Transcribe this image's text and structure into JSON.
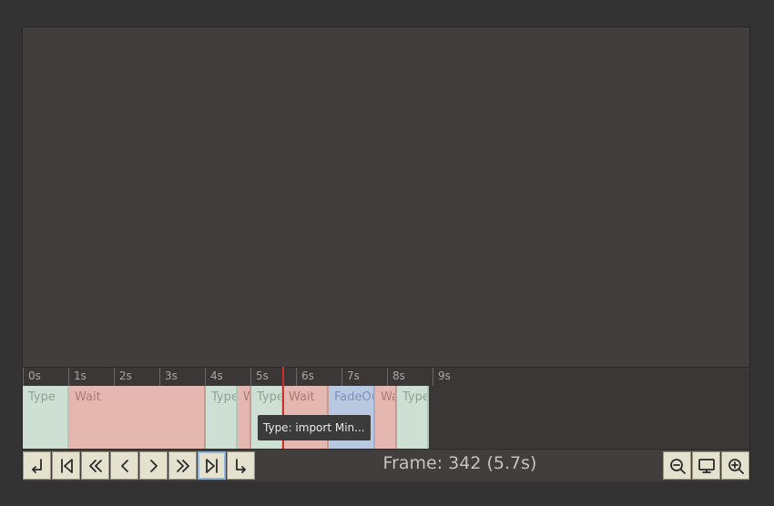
{
  "timeline": {
    "ticks": [
      "0s",
      "1s",
      "2s",
      "3s",
      "4s",
      "5s",
      "6s",
      "7s",
      "8s",
      "9s"
    ],
    "segments": [
      {
        "kind": "type",
        "label": "Type"
      },
      {
        "kind": "wait",
        "label": "Wait"
      },
      {
        "kind": "type",
        "label": "Type"
      },
      {
        "kind": "wait",
        "label": "Wait"
      },
      {
        "kind": "type",
        "label": "Type"
      },
      {
        "kind": "wait",
        "label": "Wait"
      },
      {
        "kind": "fade",
        "label": "FadeOut"
      },
      {
        "kind": "wait",
        "label": "Wait"
      },
      {
        "kind": "type",
        "label": "Type"
      }
    ],
    "tooltip": "Type: import Min...",
    "frame_label": "Frame: 342 (5.7s)"
  },
  "controls": {
    "left": [
      "step-back-out-icon",
      "skip-to-start-icon",
      "fast-rewind-icon",
      "previous-frame-icon",
      "next-frame-icon",
      "fast-forward-icon",
      "skip-to-end-icon",
      "step-forward-out-icon"
    ],
    "right": [
      "zoom-out-icon",
      "monitor-icon",
      "zoom-in-icon"
    ]
  }
}
